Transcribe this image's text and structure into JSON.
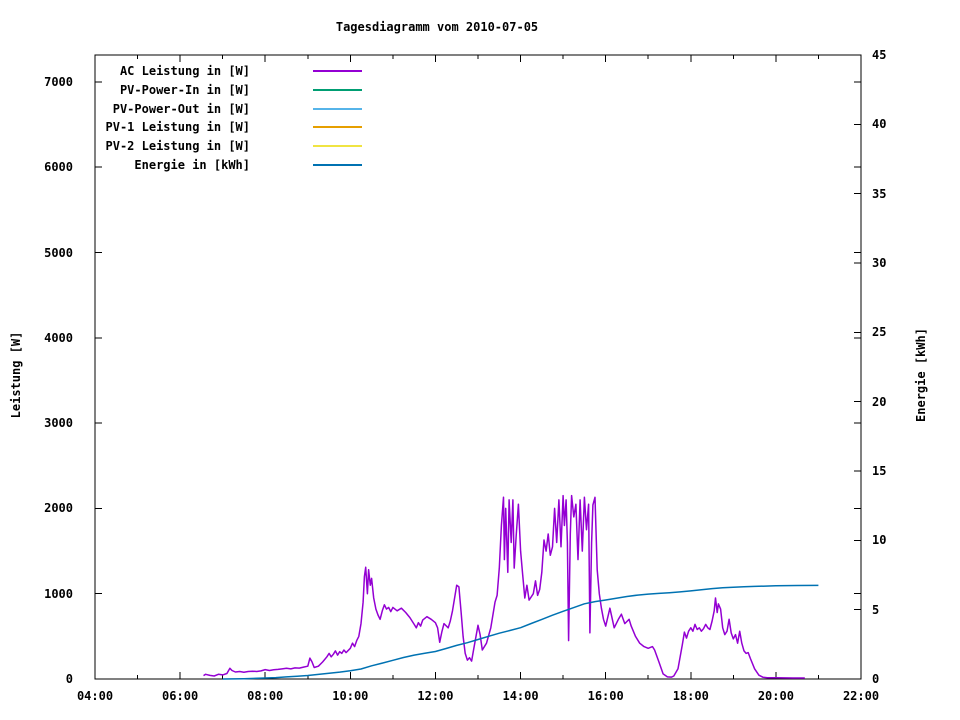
{
  "title": "Tagesdiagramm vom 2010-07-05",
  "colors": {
    "background": "#ffffff",
    "axis": "#000000",
    "ac_leistung": "#9400d3",
    "pv_power_in": "#009e73",
    "pv_power_out": "#56b4e9",
    "pv1_leistung": "#e69f00",
    "pv2_leistung": "#f0e442",
    "energie": "#0072b2"
  },
  "chart_data": {
    "type": "line",
    "title": "Tagesdiagramm vom 2010-07-05",
    "grid": false,
    "legend_position": "top-left-inside",
    "x_axis": {
      "label": "",
      "range_hours": [
        4,
        22
      ],
      "tick_positions_hours": [
        4,
        6,
        8,
        10,
        12,
        14,
        16,
        18,
        20,
        22
      ],
      "tick_labels": [
        "04:00",
        "06:00",
        "08:00",
        "10:00",
        "12:00",
        "14:00",
        "16:00",
        "18:00",
        "20:00",
        "22:00"
      ],
      "minor_tick_hours": [
        5,
        7,
        9,
        11,
        13,
        15,
        17,
        19,
        21
      ]
    },
    "y_axis": {
      "label": "Leistung [W]",
      "range": [
        0,
        7316
      ],
      "tick_values": [
        0,
        1000,
        2000,
        3000,
        4000,
        5000,
        6000,
        7000
      ],
      "tick_labels": [
        "0",
        "1000",
        "2000",
        "3000",
        "4000",
        "5000",
        "6000",
        "7000"
      ]
    },
    "y2_axis": {
      "label": "Energie [kWh]",
      "range": [
        0,
        45
      ],
      "tick_values": [
        0,
        5,
        10,
        15,
        20,
        25,
        30,
        35,
        40,
        45
      ],
      "tick_labels": [
        "0",
        "5",
        "10",
        "15",
        "20",
        "25",
        "30",
        "35",
        "40",
        "45"
      ]
    },
    "series": [
      {
        "name": "AC Leistung in [W]",
        "color": "#9400d3",
        "axis": "y",
        "points": [
          [
            6.55,
            40
          ],
          [
            6.6,
            55
          ],
          [
            6.7,
            42
          ],
          [
            6.8,
            35
          ],
          [
            6.9,
            55
          ],
          [
            7.0,
            48
          ],
          [
            7.1,
            65
          ],
          [
            7.17,
            125
          ],
          [
            7.22,
            100
          ],
          [
            7.3,
            82
          ],
          [
            7.4,
            88
          ],
          [
            7.5,
            80
          ],
          [
            7.6,
            88
          ],
          [
            7.7,
            92
          ],
          [
            7.8,
            88
          ],
          [
            7.9,
            95
          ],
          [
            8.0,
            110
          ],
          [
            8.1,
            100
          ],
          [
            8.2,
            108
          ],
          [
            8.3,
            112
          ],
          [
            8.4,
            118
          ],
          [
            8.5,
            125
          ],
          [
            8.6,
            118
          ],
          [
            8.7,
            130
          ],
          [
            8.8,
            128
          ],
          [
            8.9,
            140
          ],
          [
            9.0,
            150
          ],
          [
            9.05,
            245
          ],
          [
            9.1,
            200
          ],
          [
            9.15,
            135
          ],
          [
            9.25,
            150
          ],
          [
            9.35,
            200
          ],
          [
            9.45,
            260
          ],
          [
            9.5,
            300
          ],
          [
            9.55,
            260
          ],
          [
            9.6,
            290
          ],
          [
            9.65,
            330
          ],
          [
            9.7,
            280
          ],
          [
            9.75,
            320
          ],
          [
            9.8,
            300
          ],
          [
            9.85,
            340
          ],
          [
            9.9,
            310
          ],
          [
            10.0,
            360
          ],
          [
            10.05,
            420
          ],
          [
            10.1,
            380
          ],
          [
            10.15,
            450
          ],
          [
            10.2,
            500
          ],
          [
            10.25,
            650
          ],
          [
            10.3,
            900
          ],
          [
            10.33,
            1200
          ],
          [
            10.36,
            1310
          ],
          [
            10.4,
            1000
          ],
          [
            10.43,
            1280
          ],
          [
            10.47,
            1100
          ],
          [
            10.5,
            1180
          ],
          [
            10.55,
            950
          ],
          [
            10.6,
            820
          ],
          [
            10.65,
            750
          ],
          [
            10.7,
            700
          ],
          [
            10.75,
            800
          ],
          [
            10.8,
            870
          ],
          [
            10.85,
            820
          ],
          [
            10.9,
            840
          ],
          [
            10.95,
            790
          ],
          [
            11.0,
            840
          ],
          [
            11.1,
            800
          ],
          [
            11.2,
            830
          ],
          [
            11.3,
            780
          ],
          [
            11.4,
            720
          ],
          [
            11.5,
            640
          ],
          [
            11.55,
            600
          ],
          [
            11.6,
            660
          ],
          [
            11.65,
            620
          ],
          [
            11.7,
            690
          ],
          [
            11.8,
            730
          ],
          [
            11.9,
            700
          ],
          [
            12.0,
            660
          ],
          [
            12.05,
            600
          ],
          [
            12.1,
            430
          ],
          [
            12.15,
            550
          ],
          [
            12.2,
            650
          ],
          [
            12.3,
            600
          ],
          [
            12.35,
            680
          ],
          [
            12.4,
            800
          ],
          [
            12.45,
            950
          ],
          [
            12.5,
            1100
          ],
          [
            12.55,
            1080
          ],
          [
            12.6,
            800
          ],
          [
            12.65,
            500
          ],
          [
            12.7,
            300
          ],
          [
            12.75,
            220
          ],
          [
            12.8,
            250
          ],
          [
            12.85,
            210
          ],
          [
            12.9,
            350
          ],
          [
            13.0,
            630
          ],
          [
            13.05,
            520
          ],
          [
            13.1,
            340
          ],
          [
            13.2,
            420
          ],
          [
            13.3,
            600
          ],
          [
            13.35,
            750
          ],
          [
            13.4,
            900
          ],
          [
            13.45,
            980
          ],
          [
            13.5,
            1300
          ],
          [
            13.55,
            1800
          ],
          [
            13.6,
            2130
          ],
          [
            13.62,
            1400
          ],
          [
            13.65,
            2000
          ],
          [
            13.7,
            1250
          ],
          [
            13.73,
            2100
          ],
          [
            13.78,
            1600
          ],
          [
            13.82,
            2100
          ],
          [
            13.85,
            1300
          ],
          [
            13.9,
            1700
          ],
          [
            13.95,
            2050
          ],
          [
            14.0,
            1500
          ],
          [
            14.05,
            1220
          ],
          [
            14.1,
            950
          ],
          [
            14.15,
            1100
          ],
          [
            14.2,
            925
          ],
          [
            14.3,
            1000
          ],
          [
            14.35,
            1150
          ],
          [
            14.4,
            980
          ],
          [
            14.45,
            1050
          ],
          [
            14.5,
            1250
          ],
          [
            14.55,
            1630
          ],
          [
            14.6,
            1500
          ],
          [
            14.65,
            1700
          ],
          [
            14.7,
            1450
          ],
          [
            14.75,
            1550
          ],
          [
            14.8,
            2000
          ],
          [
            14.85,
            1600
          ],
          [
            14.9,
            2100
          ],
          [
            14.95,
            1550
          ],
          [
            15.0,
            2150
          ],
          [
            15.03,
            1800
          ],
          [
            15.07,
            2100
          ],
          [
            15.1,
            1600
          ],
          [
            15.13,
            450
          ],
          [
            15.17,
            1700
          ],
          [
            15.2,
            2150
          ],
          [
            15.25,
            1900
          ],
          [
            15.3,
            2050
          ],
          [
            15.35,
            1400
          ],
          [
            15.4,
            2100
          ],
          [
            15.45,
            1500
          ],
          [
            15.5,
            2130
          ],
          [
            15.55,
            1750
          ],
          [
            15.6,
            2050
          ],
          [
            15.63,
            540
          ],
          [
            15.67,
            1600
          ],
          [
            15.7,
            2040
          ],
          [
            15.75,
            2130
          ],
          [
            15.8,
            1280
          ],
          [
            15.85,
            1000
          ],
          [
            15.9,
            830
          ],
          [
            15.95,
            700
          ],
          [
            16.0,
            620
          ],
          [
            16.1,
            830
          ],
          [
            16.2,
            600
          ],
          [
            16.3,
            700
          ],
          [
            16.37,
            760
          ],
          [
            16.45,
            650
          ],
          [
            16.55,
            700
          ],
          [
            16.6,
            620
          ],
          [
            16.7,
            500
          ],
          [
            16.8,
            420
          ],
          [
            16.9,
            380
          ],
          [
            17.0,
            360
          ],
          [
            17.1,
            380
          ],
          [
            17.15,
            340
          ],
          [
            17.25,
            200
          ],
          [
            17.35,
            60
          ],
          [
            17.45,
            25
          ],
          [
            17.55,
            22
          ],
          [
            17.6,
            35
          ],
          [
            17.7,
            120
          ],
          [
            17.8,
            400
          ],
          [
            17.85,
            550
          ],
          [
            17.9,
            480
          ],
          [
            17.95,
            560
          ],
          [
            18.0,
            600
          ],
          [
            18.05,
            560
          ],
          [
            18.1,
            640
          ],
          [
            18.15,
            580
          ],
          [
            18.2,
            600
          ],
          [
            18.25,
            560
          ],
          [
            18.3,
            590
          ],
          [
            18.35,
            640
          ],
          [
            18.4,
            600
          ],
          [
            18.45,
            580
          ],
          [
            18.5,
            680
          ],
          [
            18.55,
            800
          ],
          [
            18.58,
            950
          ],
          [
            18.62,
            780
          ],
          [
            18.65,
            880
          ],
          [
            18.7,
            820
          ],
          [
            18.75,
            600
          ],
          [
            18.8,
            520
          ],
          [
            18.85,
            560
          ],
          [
            18.9,
            700
          ],
          [
            18.95,
            540
          ],
          [
            19.0,
            470
          ],
          [
            19.05,
            520
          ],
          [
            19.1,
            420
          ],
          [
            19.15,
            560
          ],
          [
            19.2,
            420
          ],
          [
            19.25,
            330
          ],
          [
            19.3,
            300
          ],
          [
            19.35,
            310
          ],
          [
            19.4,
            240
          ],
          [
            19.5,
            120
          ],
          [
            19.6,
            45
          ],
          [
            19.7,
            20
          ],
          [
            19.8,
            15
          ],
          [
            20.0,
            14
          ],
          [
            20.2,
            13
          ],
          [
            20.4,
            12
          ],
          [
            20.68,
            12
          ]
        ]
      },
      {
        "name": "PV-Power-In in [W]",
        "color": "#009e73",
        "axis": "y",
        "points": []
      },
      {
        "name": "PV-Power-Out in [W]",
        "color": "#56b4e9",
        "axis": "y",
        "points": []
      },
      {
        "name": "PV-1 Leistung in [W]",
        "color": "#e69f00",
        "axis": "y",
        "points": []
      },
      {
        "name": "PV-2 Leistung in [W]",
        "color": "#f0e442",
        "axis": "y",
        "points": []
      },
      {
        "name": "Energie in [kWh]",
        "color": "#0072b2",
        "axis": "y2",
        "points": [
          [
            7.0,
            0
          ],
          [
            7.5,
            0.02
          ],
          [
            8.0,
            0.07
          ],
          [
            8.25,
            0.1
          ],
          [
            8.5,
            0.15
          ],
          [
            8.75,
            0.2
          ],
          [
            9.0,
            0.25
          ],
          [
            9.25,
            0.33
          ],
          [
            9.5,
            0.42
          ],
          [
            9.75,
            0.5
          ],
          [
            10.0,
            0.6
          ],
          [
            10.25,
            0.72
          ],
          [
            10.5,
            0.95
          ],
          [
            10.75,
            1.15
          ],
          [
            11.0,
            1.35
          ],
          [
            11.25,
            1.55
          ],
          [
            11.5,
            1.72
          ],
          [
            11.75,
            1.85
          ],
          [
            12.0,
            1.98
          ],
          [
            12.25,
            2.2
          ],
          [
            12.5,
            2.42
          ],
          [
            12.75,
            2.62
          ],
          [
            13.0,
            2.85
          ],
          [
            13.25,
            3.08
          ],
          [
            13.5,
            3.3
          ],
          [
            13.75,
            3.5
          ],
          [
            14.0,
            3.7
          ],
          [
            14.25,
            4.0
          ],
          [
            14.5,
            4.3
          ],
          [
            14.75,
            4.6
          ],
          [
            15.0,
            4.88
          ],
          [
            15.25,
            5.15
          ],
          [
            15.5,
            5.42
          ],
          [
            15.75,
            5.58
          ],
          [
            16.0,
            5.7
          ],
          [
            16.25,
            5.82
          ],
          [
            16.5,
            5.95
          ],
          [
            16.75,
            6.05
          ],
          [
            17.0,
            6.12
          ],
          [
            17.25,
            6.17
          ],
          [
            17.5,
            6.22
          ],
          [
            17.75,
            6.28
          ],
          [
            18.0,
            6.35
          ],
          [
            18.25,
            6.44
          ],
          [
            18.5,
            6.52
          ],
          [
            18.75,
            6.58
          ],
          [
            19.0,
            6.62
          ],
          [
            19.25,
            6.65
          ],
          [
            19.5,
            6.68
          ],
          [
            19.75,
            6.7
          ],
          [
            20.0,
            6.72
          ],
          [
            20.5,
            6.74
          ],
          [
            21.0,
            6.75
          ]
        ]
      }
    ]
  }
}
